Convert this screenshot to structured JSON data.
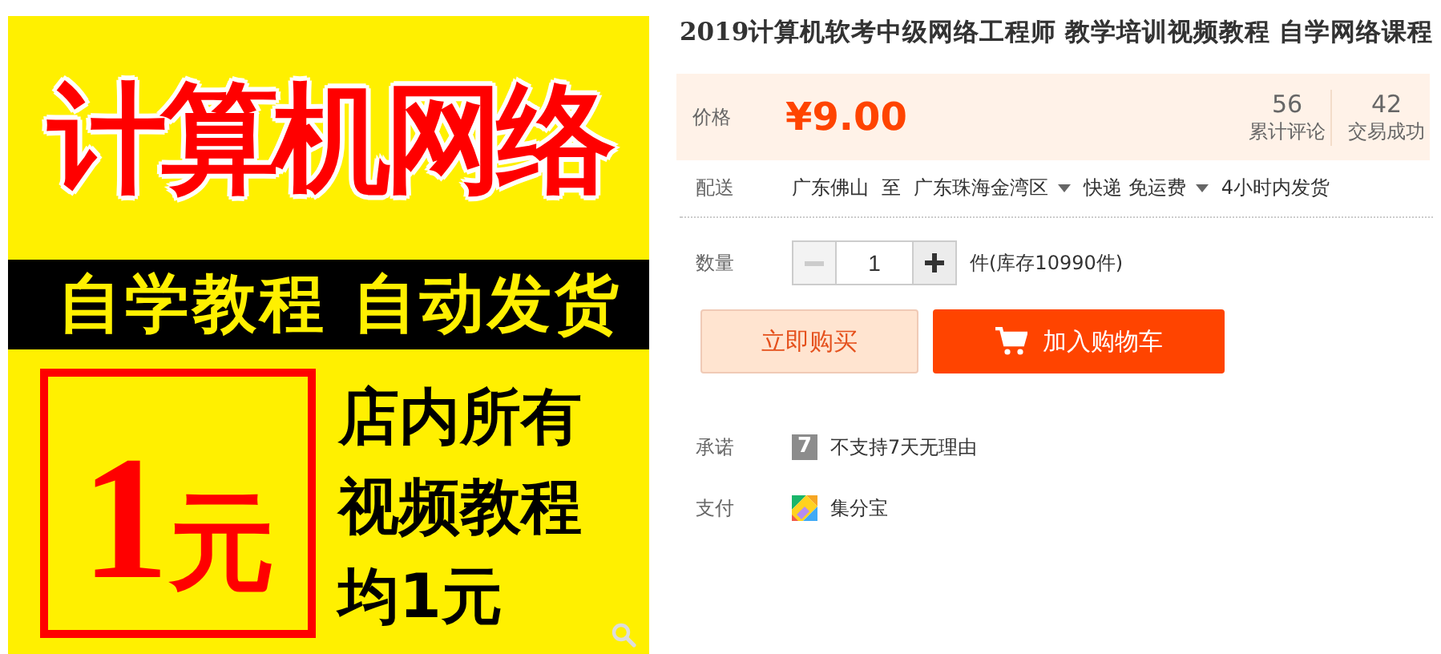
{
  "banner": {
    "headline": "计算机网络",
    "tagline": "自学教程 自动发货",
    "price_amount": "1",
    "price_unit": "元",
    "lines": [
      "店内所有",
      "视频教程",
      "均1元"
    ]
  },
  "title": "2019计算机软考中级网络工程师 教学培训视频教程 自学网络课程",
  "price": {
    "label": "价格",
    "value": "¥9.00"
  },
  "stats": [
    {
      "value": "56",
      "label": "累计评论"
    },
    {
      "value": "42",
      "label": "交易成功"
    }
  ],
  "delivery": {
    "label": "配送",
    "from": "广东佛山",
    "to_word": "至",
    "to": "广东珠海金湾区",
    "shipping": "快递 免运费",
    "time": "4小时内发货"
  },
  "quantity": {
    "label": "数量",
    "value": "1",
    "minus_disabled": true,
    "stock": "件(库存10990件)"
  },
  "buttons": {
    "buy_now": "立即购买",
    "add_to_cart": "加入购物车"
  },
  "promise": {
    "label": "承诺",
    "badge": "7",
    "text": "不支持7天无理由"
  },
  "payment": {
    "label": "支付",
    "text": "集分宝"
  }
}
